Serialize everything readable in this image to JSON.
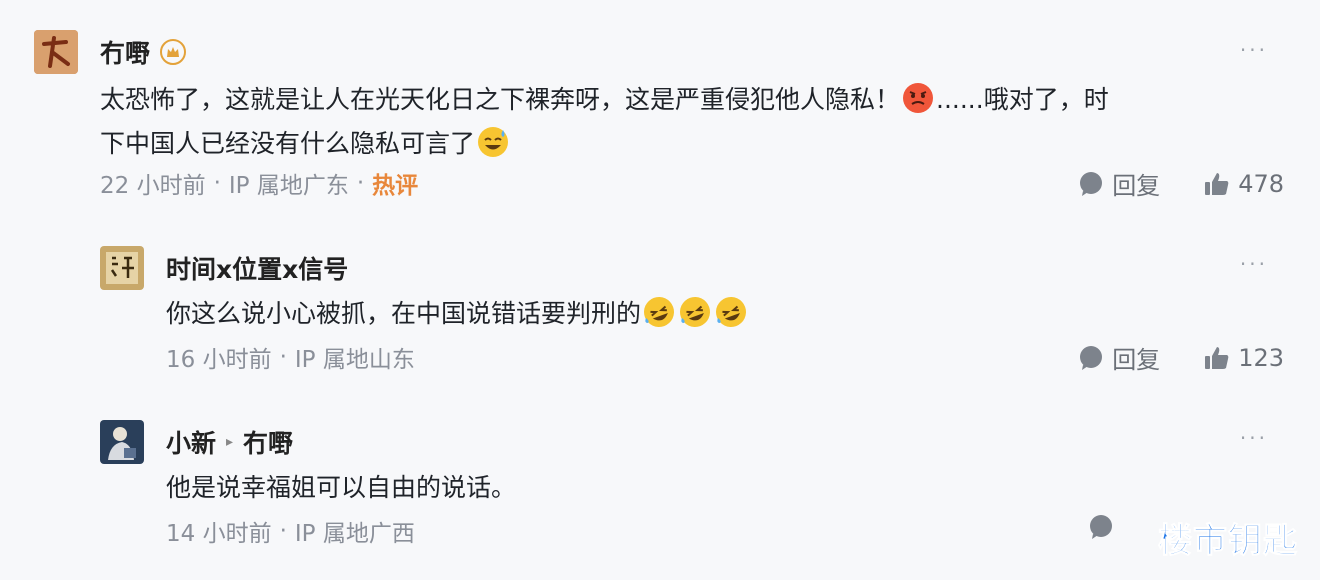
{
  "comments": [
    {
      "name": "冇嘢",
      "text_line1_a": "太恐怖了，这就是让人在光天化日之下裸奔呀，这是严重侵犯他人隐私！",
      "text_line1_b": "......哦对了，时",
      "text_line2": "下中国人已经没有什么隐私可言了",
      "time": "22 小时前",
      "sep": "·",
      "ip": "IP 属地广东",
      "hot_label": "热评",
      "reply_label": "回复",
      "likes": "478",
      "more": "···"
    },
    {
      "name": "时间x位置x信号",
      "text": "你这么说小心被抓，在中国说错话要判刑的",
      "time": "16 小时前",
      "sep": "·",
      "ip": "IP 属地山东",
      "reply_label": "回复",
      "likes": "123",
      "more": "···"
    },
    {
      "name": "小新",
      "reply_to": "冇嘢",
      "text": "他是说幸福姐可以自由的说话。",
      "time": "14 小时前",
      "sep": "·",
      "ip": "IP 属地广西",
      "more": "···"
    }
  ],
  "watermark": "楼市钥匙",
  "colors": {
    "hot": "#e8873b",
    "watermark": "#1a73e8"
  }
}
